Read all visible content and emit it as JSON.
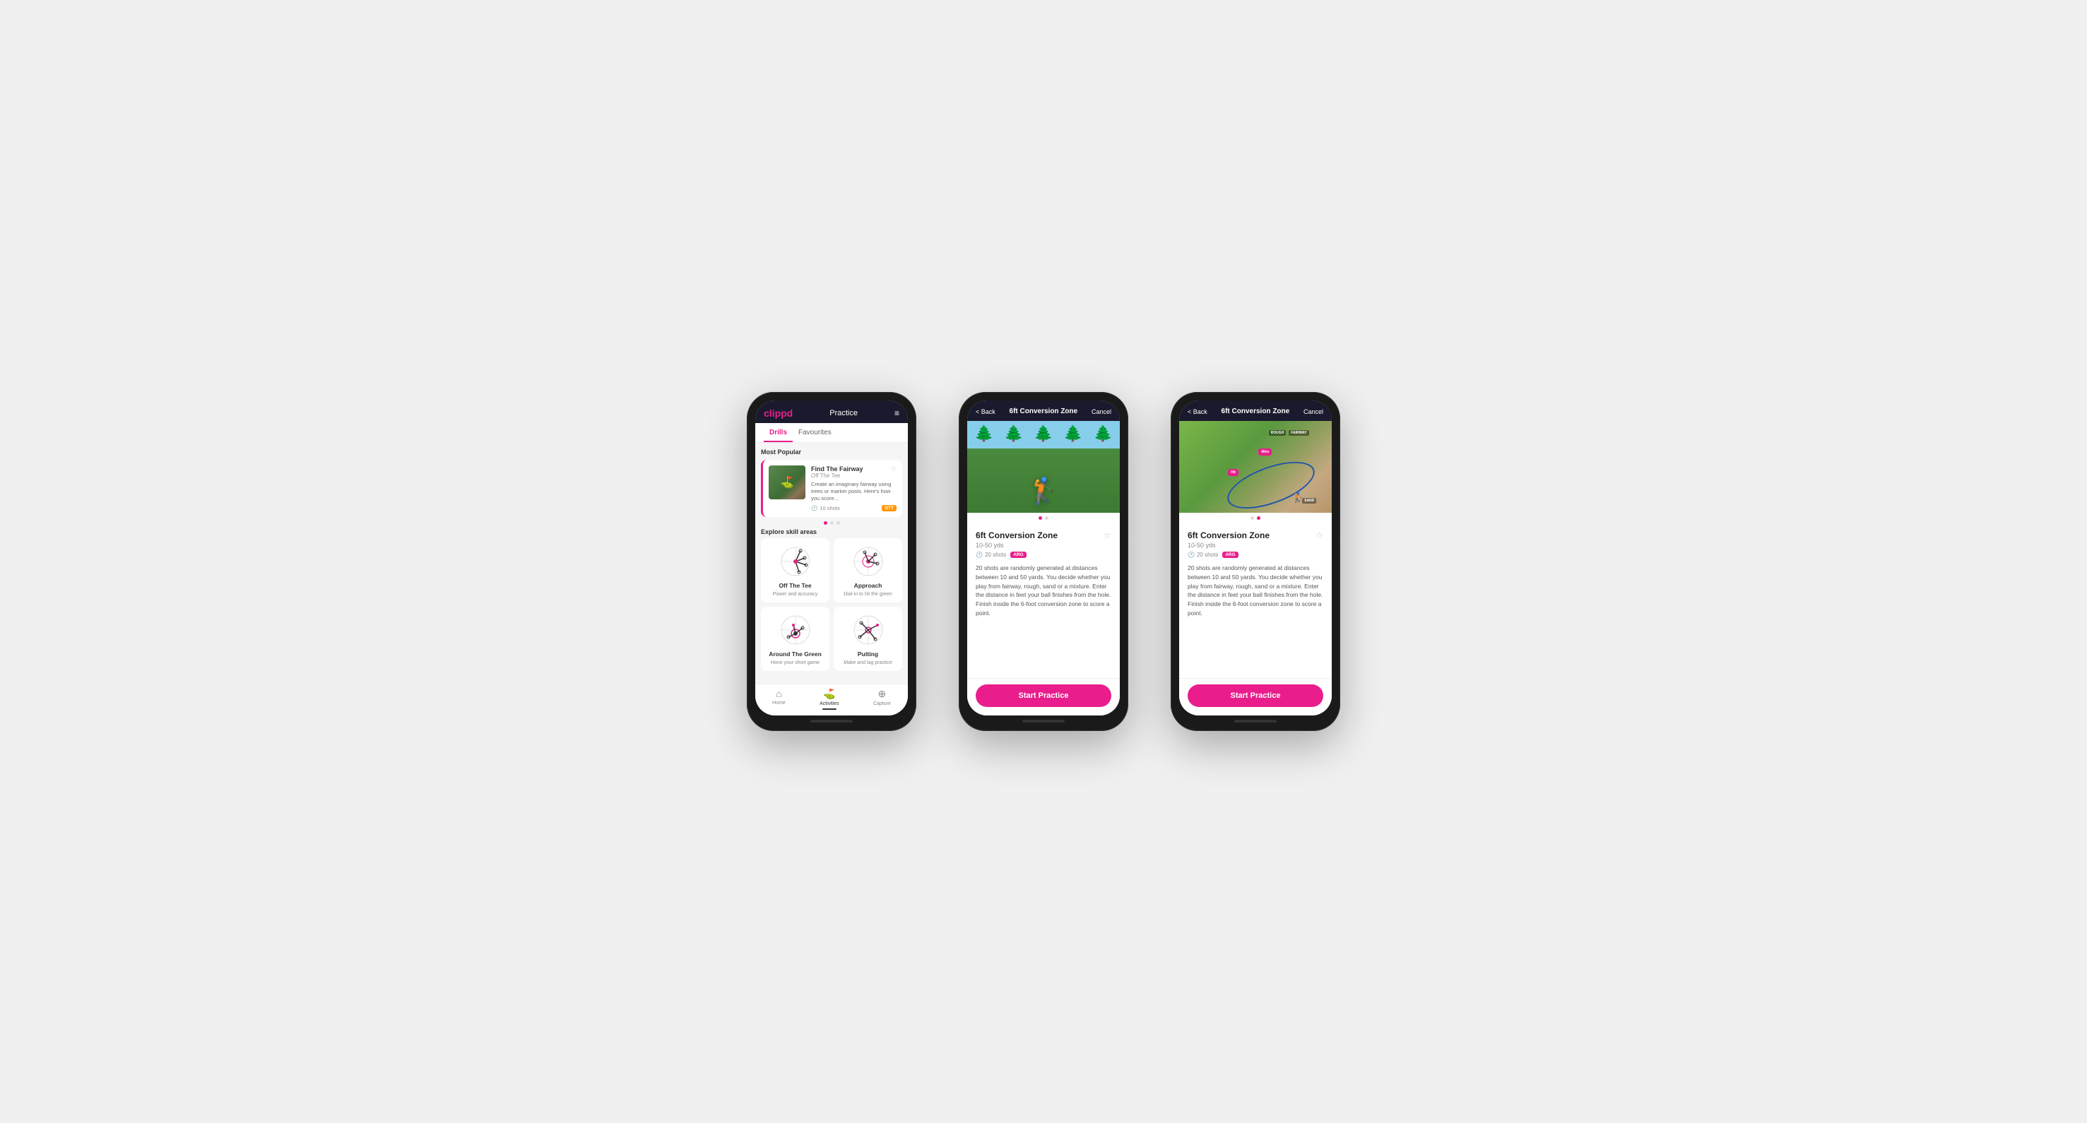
{
  "phone1": {
    "header": {
      "logo": "clippd",
      "title": "Practice",
      "menu_icon": "≡"
    },
    "tabs": [
      {
        "label": "Drills",
        "active": true
      },
      {
        "label": "Favourites",
        "active": false
      }
    ],
    "most_popular_label": "Most Popular",
    "featured_card": {
      "title": "Find The Fairway",
      "subtitle": "Off The Tee",
      "description": "Create an imaginary fairway using trees or marker posts. Here's how you score...",
      "shots": "10 shots",
      "tag": "OTT",
      "star_icon": "☆"
    },
    "dots": [
      {
        "active": true
      },
      {
        "active": false
      },
      {
        "active": false
      }
    ],
    "explore_label": "Explore skill areas",
    "skills": [
      {
        "name": "Off The Tee",
        "desc": "Power and accuracy"
      },
      {
        "name": "Approach",
        "desc": "Dial-in to hit the green"
      },
      {
        "name": "Around The Green",
        "desc": "Hone your short game"
      },
      {
        "name": "Putting",
        "desc": "Make and lag practice"
      }
    ],
    "nav": [
      {
        "label": "Home",
        "icon": "🏠",
        "active": false
      },
      {
        "label": "Activities",
        "icon": "⛳",
        "active": true
      },
      {
        "label": "Capture",
        "icon": "⊕",
        "active": false
      }
    ]
  },
  "phone2": {
    "header": {
      "back_label": "< Back",
      "title": "6ft Conversion Zone",
      "cancel_label": "Cancel"
    },
    "drill": {
      "name": "6ft Conversion Zone",
      "distance": "10-50 yds",
      "shots": "20 shots",
      "tag": "ARG",
      "star_icon": "☆",
      "description": "20 shots are randomly generated at distances between 10 and 50 yards. You decide whether you play from fairway, rough, sand or a mixture. Enter the distance in feet your ball finishes from the hole. Finish inside the 6-foot conversion zone to score a point."
    },
    "start_button": "Start Practice",
    "image_dots": [
      {
        "active": true
      },
      {
        "active": false
      }
    ]
  },
  "phone3": {
    "header": {
      "back_label": "< Back",
      "title": "6ft Conversion Zone",
      "cancel_label": "Cancel"
    },
    "drill": {
      "name": "6ft Conversion Zone",
      "distance": "10-50 yds",
      "shots": "20 shots",
      "tag": "ARG",
      "star_icon": "☆",
      "description": "20 shots are randomly generated at distances between 10 and 50 yards. You decide whether you play from fairway, rough, sand or a mixture. Enter the distance in feet your ball finishes from the hole. Finish inside the 6-foot conversion zone to score a point."
    },
    "map_labels": {
      "fairway": "FAIRWAY",
      "rough": "ROUGH",
      "hit": "Hit",
      "miss": "Miss",
      "sand": "SAND"
    },
    "start_button": "Start Practice",
    "image_dots": [
      {
        "active": false
      },
      {
        "active": true
      }
    ]
  }
}
